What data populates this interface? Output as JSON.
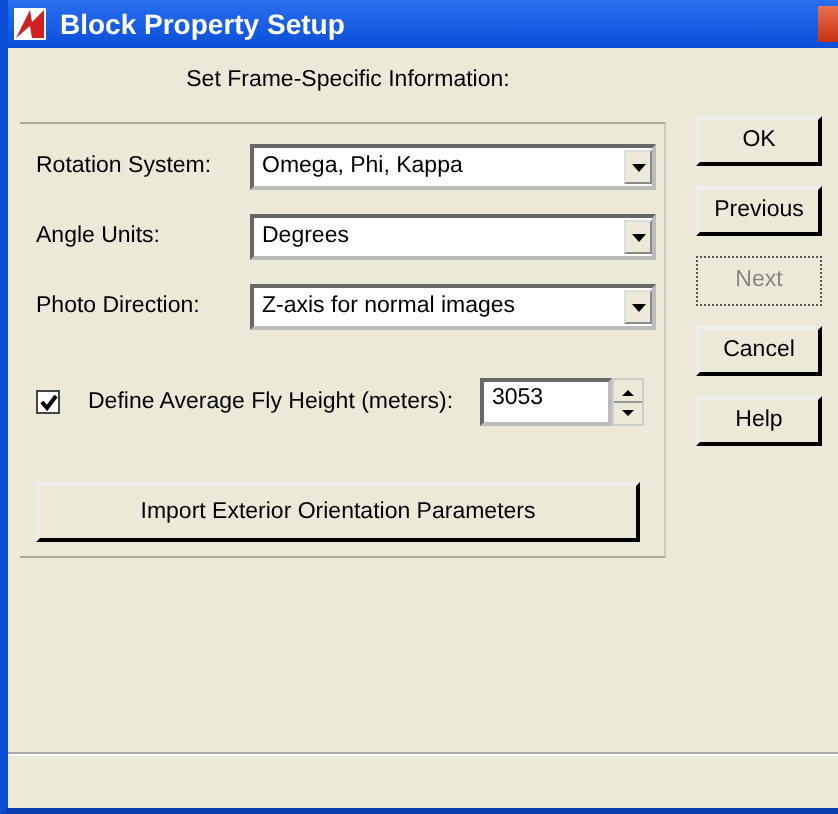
{
  "window": {
    "title": "Block Property Setup"
  },
  "header": "Set Frame-Specific Information:",
  "fields": [
    {
      "label": "Rotation System:",
      "value": "Omega, Phi, Kappa"
    },
    {
      "label": "Angle Units:",
      "value": "Degrees"
    },
    {
      "label": "Photo Direction:",
      "value": "Z-axis for normal images"
    }
  ],
  "fly_height": {
    "label": "Define Average Fly Height (meters):",
    "checked": true,
    "value": "3053"
  },
  "import_button": "Import Exterior Orientation Parameters",
  "buttons": [
    {
      "label": "OK",
      "disabled": false
    },
    {
      "label": "Previous",
      "disabled": false
    },
    {
      "label": "Next",
      "disabled": true
    },
    {
      "label": "Cancel",
      "disabled": false
    },
    {
      "label": "Help",
      "disabled": false
    }
  ]
}
